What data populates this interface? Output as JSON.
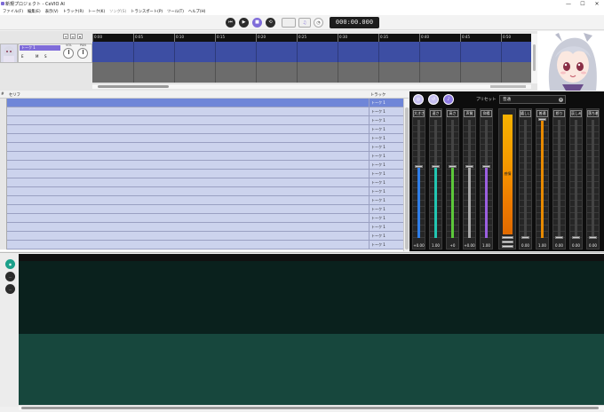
{
  "window": {
    "title": "新規プロジェクト - CeVIO AI",
    "controls": [
      "—",
      "☐",
      "✕"
    ]
  },
  "menu": [
    {
      "label": "ファイル(F)",
      "enabled": true
    },
    {
      "label": "編集(E)",
      "enabled": true
    },
    {
      "label": "表示(V)",
      "enabled": true
    },
    {
      "label": "トラック(R)",
      "enabled": true
    },
    {
      "label": "トーク(K)",
      "enabled": true
    },
    {
      "label": "ソング(S)",
      "enabled": false
    },
    {
      "label": "トランスポート(P)",
      "enabled": true
    },
    {
      "label": "ツール(T)",
      "enabled": true
    },
    {
      "label": "ヘルプ(H)",
      "enabled": true
    }
  ],
  "transport": {
    "rewind_icon": "⏮",
    "play_icon": "▶",
    "stop_icon": "■",
    "loop_icon": "⟲",
    "time": "000:00.000"
  },
  "track": {
    "name": "トーク 1",
    "knob_labels": [
      "VOL",
      "PAN"
    ],
    "small_labels": [
      "E",
      "M",
      "S"
    ],
    "ruler": [
      "0:00",
      "0:05",
      "0:10",
      "0:15",
      "0:20",
      "0:25",
      "0:30",
      "0:35",
      "0:40",
      "0:45",
      "0:50"
    ]
  },
  "script_list": {
    "headers": {
      "num": "#",
      "serif": "セリフ",
      "track": "トラック"
    },
    "rows": [
      {
        "track": "トーク 1"
      },
      {
        "track": "トーク 1"
      },
      {
        "track": "トーク 1"
      },
      {
        "track": "トーク 1"
      },
      {
        "track": "トーク 1"
      },
      {
        "track": "トーク 1"
      },
      {
        "track": "トーク 1"
      },
      {
        "track": "トーク 1"
      },
      {
        "track": "トーク 1"
      },
      {
        "track": "トーク 1"
      },
      {
        "track": "トーク 1"
      },
      {
        "track": "トーク 1"
      },
      {
        "track": "トーク 1"
      },
      {
        "track": "トーク 1"
      },
      {
        "track": "トーク 1"
      },
      {
        "track": "トーク 1"
      },
      {
        "track": "トーク 1"
      }
    ]
  },
  "mixer": {
    "preset_label": "プリセット",
    "preset_value": "普通",
    "master_label": "感情",
    "strips": [
      {
        "label": "大きさ",
        "value": "+0.00",
        "color": "#2f7ee8",
        "level": 0.6
      },
      {
        "label": "速さ",
        "value": "1.00",
        "color": "#22c6b2",
        "level": 0.6
      },
      {
        "label": "高さ",
        "value": "+0",
        "color": "#5cc83a",
        "level": 0.6
      },
      {
        "label": "声質",
        "value": "+0.00",
        "color": "#a8a8a8",
        "level": 0.6
      },
      {
        "label": "抑揚",
        "value": "1.00",
        "color": "#9b5fe0",
        "level": 0.6
      },
      {
        "label": "嬉しい",
        "value": "0.00",
        "color": "#e88a00",
        "level": 0.0
      },
      {
        "label": "普通",
        "value": "1.00",
        "color": "#e88a00",
        "level": 1.0
      },
      {
        "label": "怒り",
        "value": "0.00",
        "color": "#e88a00",
        "level": 0.0
      },
      {
        "label": "哀しみ",
        "value": "0.00",
        "color": "#e88a00",
        "level": 0.0
      },
      {
        "label": "落ち着き",
        "value": "0.00",
        "color": "#e88a00",
        "level": 0.0
      }
    ]
  },
  "editor": {
    "side_buttons": [
      "…",
      "…",
      "…"
    ]
  },
  "colors": {
    "accent": "#7f6cd9",
    "lane_blue": "#3d4ea3",
    "selected_row": "#6f86d8",
    "row": "#ccd3ed",
    "editor_dark": "#0a211d",
    "editor_light": "#17473d",
    "master_meter": "#f59a00"
  }
}
